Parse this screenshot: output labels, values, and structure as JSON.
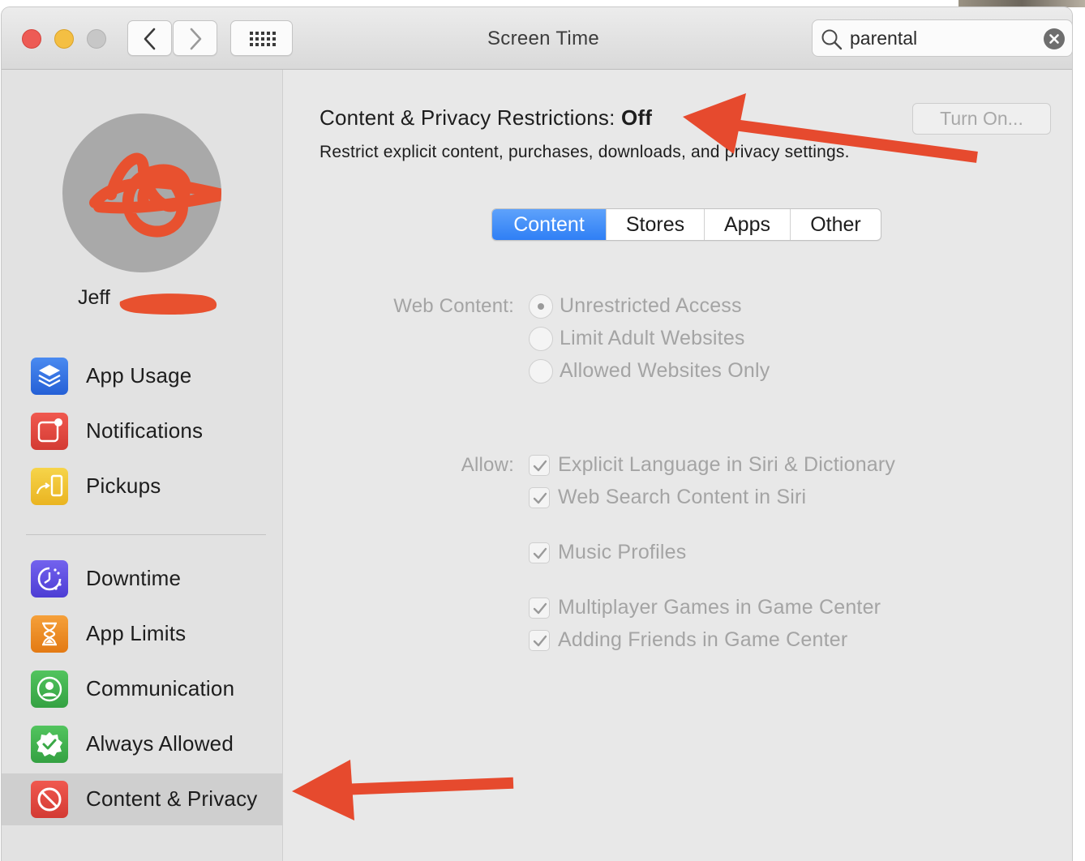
{
  "window": {
    "title": "Screen Time"
  },
  "search": {
    "value": "parental"
  },
  "user": {
    "name": "Jeff"
  },
  "sidebar": {
    "items": [
      {
        "label": "App Usage",
        "icon": "stack-icon",
        "color": "#2f6fe0"
      },
      {
        "label": "Notifications",
        "icon": "notification-badge-icon",
        "color": "#e0443d"
      },
      {
        "label": "Pickups",
        "icon": "pickup-phone-icon",
        "color": "#f2c42b"
      },
      {
        "label": "Downtime",
        "icon": "downtime-clock-icon",
        "color": "#5f4ee0"
      },
      {
        "label": "App Limits",
        "icon": "hourglass-icon",
        "color": "#f08a22"
      },
      {
        "label": "Communication",
        "icon": "person-circle-icon",
        "color": "#3db04a"
      },
      {
        "label": "Always Allowed",
        "icon": "checkmark-seal-icon",
        "color": "#3db04a"
      },
      {
        "label": "Content & Privacy",
        "icon": "no-entry-icon",
        "color": "#e0443d"
      }
    ],
    "selected": "Content & Privacy"
  },
  "main": {
    "heading_prefix": "Content & Privacy Restrictions: ",
    "heading_status": "Off",
    "subheading": "Restrict explicit content, purchases, downloads, and privacy settings.",
    "turn_on_label": "Turn On...",
    "tabs": [
      "Content",
      "Stores",
      "Apps",
      "Other"
    ],
    "active_tab": "Content",
    "web_content": {
      "label": "Web Content:",
      "options": [
        "Unrestricted Access",
        "Limit Adult Websites",
        "Allowed Websites Only"
      ],
      "selected": "Unrestricted Access"
    },
    "allow": {
      "label": "Allow:",
      "options": [
        "Explicit Language in Siri & Dictionary",
        "Web Search Content in Siri",
        "Music Profiles",
        "Multiplayer Games in Game Center",
        "Adding Friends in Game Center"
      ]
    }
  },
  "colors": {
    "accent": "#2f7ff5",
    "annotation": "#e64a2e",
    "disabled_text": "#a4a4a4"
  }
}
